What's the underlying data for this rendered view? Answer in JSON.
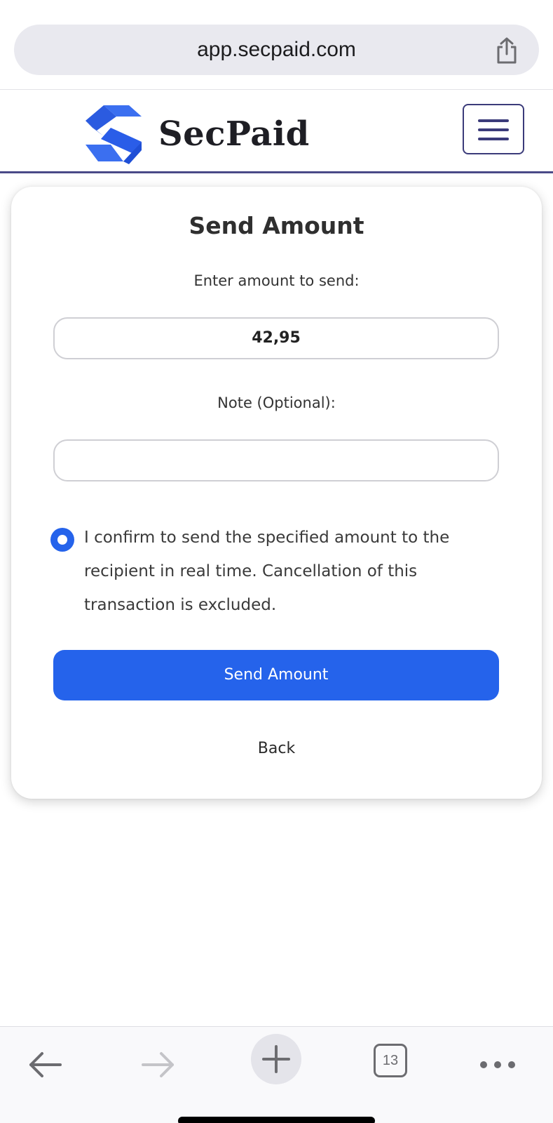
{
  "browser": {
    "url": "app.secpaid.com",
    "tab_count": "13"
  },
  "header": {
    "brand": "SecPaid",
    "logo_color": "#2563eb"
  },
  "form": {
    "title": "Send Amount",
    "amount_label": "Enter amount to send:",
    "amount_value": "42,95",
    "note_label": "Note (Optional):",
    "note_value": "",
    "confirm_text": "I confirm to send the specified amount to the recipient in real time. Cancellation of this transaction is excluded.",
    "confirm_checked": true,
    "submit_label": "Send Amount",
    "back_label": "Back"
  },
  "colors": {
    "primary": "#2563eb",
    "header_border": "#4a4a88"
  },
  "toolbar": {
    "icons": [
      "back-arrow-icon",
      "forward-arrow-icon",
      "plus-icon",
      "tabs-icon",
      "more-icon"
    ]
  }
}
